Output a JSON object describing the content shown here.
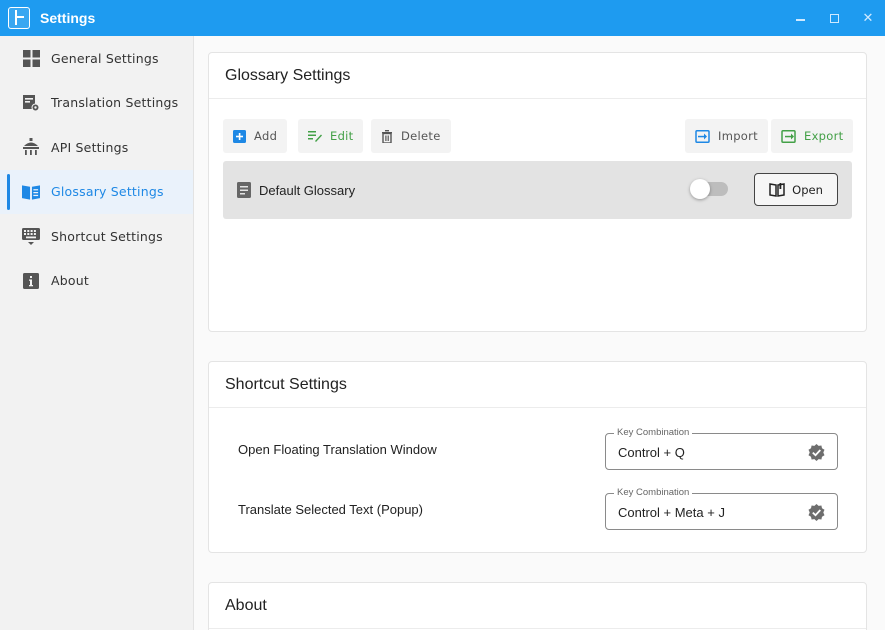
{
  "window": {
    "title": "Settings",
    "minimize_glyph": "",
    "maximize_glyph": "",
    "close_glyph": "✕"
  },
  "colors": {
    "titlebar": "#1e9bf0",
    "accent": "#1e88e5",
    "green": "#43a047"
  },
  "sidebar": {
    "items": [
      {
        "label": "General Settings",
        "icon": "grid-icon",
        "active": false
      },
      {
        "label": "Translation Settings",
        "icon": "translate-settings-icon",
        "active": false
      },
      {
        "label": "API Settings",
        "icon": "api-icon",
        "active": false
      },
      {
        "label": "Glossary Settings",
        "icon": "book-icon",
        "active": true
      },
      {
        "label": "Shortcut Settings",
        "icon": "keyboard-icon",
        "active": false
      },
      {
        "label": "About",
        "icon": "info-icon",
        "active": false
      }
    ]
  },
  "glossary": {
    "title": "Glossary Settings",
    "toolbar": {
      "add": "Add",
      "edit": "Edit",
      "delete": "Delete",
      "import": "Import",
      "export": "Export"
    },
    "items": [
      {
        "name": "Default Glossary",
        "enabled": false,
        "open_label": "Open"
      }
    ]
  },
  "shortcuts": {
    "title": "Shortcut Settings",
    "field_label": "Key Combination",
    "rows": [
      {
        "label": "Open Floating Translation Window",
        "value": "Control + Q"
      },
      {
        "label": "Translate Selected Text (Popup)",
        "value": "Control + Meta + J"
      }
    ]
  },
  "about": {
    "title": "About"
  }
}
